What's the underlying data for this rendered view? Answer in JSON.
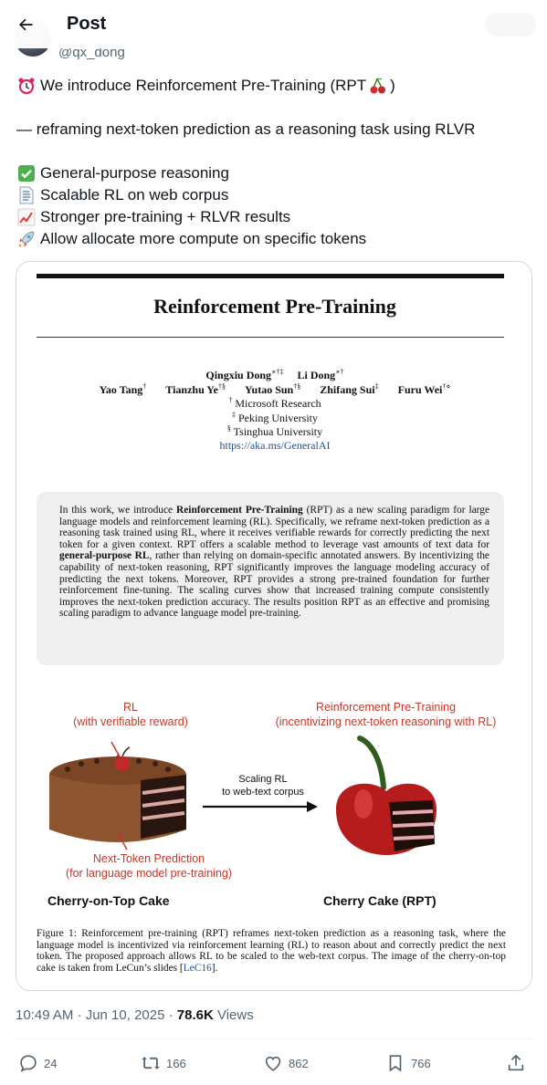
{
  "header": {
    "title": "Post"
  },
  "author": {
    "handle": "@qx_dong"
  },
  "tweet": {
    "line1": "We introduce Reinforcement Pre-Training (RPT",
    "line1_end": ")",
    "line2": "— reframing next-token prediction as a reasoning task using RLVR",
    "bullets": [
      {
        "icon": "check-mark-icon",
        "text": "General-purpose reasoning"
      },
      {
        "icon": "document-icon",
        "text": "Scalable RL on web corpus"
      },
      {
        "icon": "chart-increasing-icon",
        "text": "Stronger pre-training + RLVR results"
      },
      {
        "icon": "rocket-icon",
        "text": "Allow allocate more compute on specific tokens"
      }
    ]
  },
  "paper": {
    "title": "Reinforcement Pre-Training",
    "authors_row1": [
      {
        "name": "Qingxiu Dong",
        "sup": "∗†‡"
      },
      {
        "name": "Li Dong",
        "sup": "∗†"
      }
    ],
    "authors_row2": [
      {
        "name": "Yao Tang",
        "sup": "†"
      },
      {
        "name": "Tianzhu Ye",
        "sup": "†§"
      },
      {
        "name": "Yutao Sun",
        "sup": "†§"
      },
      {
        "name": "Zhifang Sui",
        "sup": "‡"
      },
      {
        "name": "Furu Wei",
        "sup": "†⋄"
      }
    ],
    "affiliations": [
      {
        "sym": "†",
        "name": "Microsoft Research"
      },
      {
        "sym": "‡",
        "name": "Peking University"
      },
      {
        "sym": "§",
        "name": "Tsinghua University"
      }
    ],
    "link": "https://aka.ms/GeneralAI",
    "abstract": {
      "p1": "In this work, we introduce ",
      "b1": "Reinforcement Pre-Training",
      "p2": " (RPT) as a new scaling paradigm for large language models and reinforcement learning (RL). Specifically, we reframe next-token prediction as a reasoning task trained using RL, where it receives verifiable rewards for correctly predicting the next token for a given context. RPT offers a scalable method to leverage vast amounts of text data for ",
      "b2": "general-purpose RL",
      "p3": ", rather than relying on domain-specific annotated answers. By incentivizing the capability of next-token reasoning, RPT significantly improves the language modeling accuracy of predicting the next tokens. Moreover, RPT provides a strong pre-trained foundation for further reinforcement fine-tuning. The scaling curves show that increased training compute consistently improves the next-token prediction accuracy. The results position RPT as an effective and promising scaling paradigm to advance language model pre-training."
    },
    "figure": {
      "rl_label": "RL",
      "rl_sub": "(with verifiable reward)",
      "rpt_label": "Reinforcement Pre-Training",
      "rpt_sub": "(incentivizing next-token reasoning with RL)",
      "arrow_label1": "Scaling RL",
      "arrow_label2": "to web-text corpus",
      "ntp_label": "Next-Token Prediction",
      "ntp_sub": "(for language model pre-training)",
      "left_caption": "Cherry-on-Top Cake",
      "right_caption": "Cherry Cake (RPT)"
    },
    "caption": {
      "text": "Figure 1: Reinforcement pre-training (RPT) reframes next-token prediction as a reasoning task, where the language model is incentivized via reinforcement learning (RL) to reason about and correctly predict the next token. The proposed approach allows RL to be scaled to the web-text corpus. The image of the cherry-on-top cake is taken from LeCun’s slides [",
      "ref": "LeC16",
      "end": "]."
    }
  },
  "meta": {
    "time": "10:49 AM · Jun 10, 2025 · ",
    "views_count": "78.6K",
    "views_label": " Views"
  },
  "actions": {
    "replies": "24",
    "reposts": "166",
    "likes": "862",
    "bookmarks": "766"
  },
  "colors": {
    "text": "#0f1419",
    "muted": "#536471",
    "border": "#cfd9de",
    "figure_red": "#c0392b"
  }
}
